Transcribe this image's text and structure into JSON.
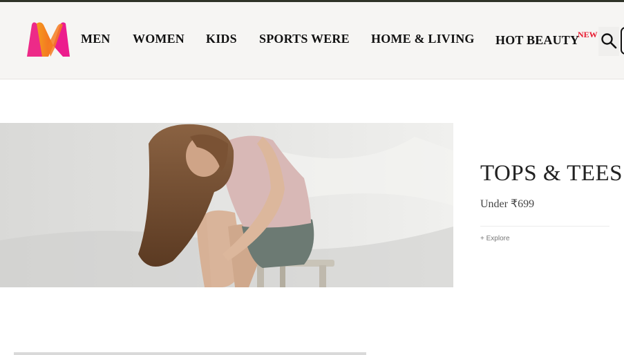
{
  "header": {
    "logo": "myntra-logo",
    "nav": [
      {
        "label": "MEN"
      },
      {
        "label": "WOMEN"
      },
      {
        "label": "KIDS"
      },
      {
        "label": "SPORTS WERE"
      },
      {
        "label": "HOME & LIVING"
      },
      {
        "label": "HOT BEAUTY"
      }
    ],
    "new_badge": "NEW",
    "search_icon": "search-icon"
  },
  "hero": {
    "title": "TOPS & TEES",
    "subtitle": "Under ₹699",
    "explore": "+ Explore"
  },
  "colors": {
    "header_bg": "#f6f5f3",
    "badge_red": "#e8182e",
    "logo_pink": "#ed2a88",
    "logo_orange": "#f78e1e"
  }
}
